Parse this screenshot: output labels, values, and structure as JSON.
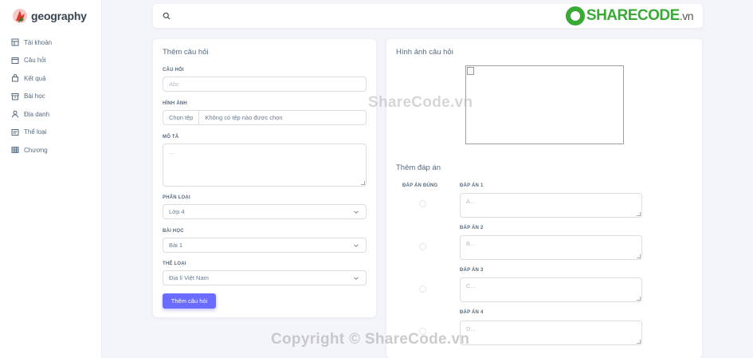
{
  "brand": {
    "name": "geography"
  },
  "sidebar": {
    "items": [
      {
        "label": "Tài khoản",
        "icon": "layout-icon"
      },
      {
        "label": "Câu hỏi",
        "icon": "window-icon"
      },
      {
        "label": "Kết quả",
        "icon": "bag-icon"
      },
      {
        "label": "Bài học",
        "icon": "archive-icon"
      },
      {
        "label": "Địa danh",
        "icon": "user-icon"
      },
      {
        "label": "Thể loại",
        "icon": "card-icon"
      },
      {
        "label": "Chương",
        "icon": "table-icon"
      }
    ]
  },
  "search": {
    "placeholder": "",
    "value": ""
  },
  "watermark_logo": {
    "main": "SHARECODE",
    "suffix": ".vn"
  },
  "watermarks": {
    "center": "ShareCode.vn",
    "bottom": "Copyright © ShareCode.vn"
  },
  "add_question": {
    "title": "Thêm câu hỏi",
    "question_label": "Câu hỏi",
    "question_placeholder": "Abc",
    "image_label": "Hình ảnh",
    "file_button": "Chọn tệp",
    "file_status": "Không có tệp nào được chọn",
    "description_label": "Mô tả",
    "description_placeholder": "...",
    "category_label": "Phân loại",
    "category_value": "Lớp 4",
    "lesson_label": "Bài học",
    "lesson_value": "Bài 1",
    "genre_label": "Thể loại",
    "genre_value": "Địa lí Việt Nam",
    "submit_label": "Thêm câu hỏi"
  },
  "preview": {
    "title": "Hình ảnh câu hỏi"
  },
  "answers": {
    "title": "Thêm đáp án",
    "correct_label": "Đáp án đúng",
    "items": [
      {
        "label": "Đáp án 1",
        "placeholder": "A..."
      },
      {
        "label": "Đáp án 2",
        "placeholder": "B..."
      },
      {
        "label": "Đáp án 3",
        "placeholder": "C..."
      },
      {
        "label": "Đáp án 4",
        "placeholder": "D..."
      }
    ]
  },
  "colors": {
    "primary": "#696cff",
    "brand_green": "#3aa935",
    "text": "#566a7f"
  }
}
